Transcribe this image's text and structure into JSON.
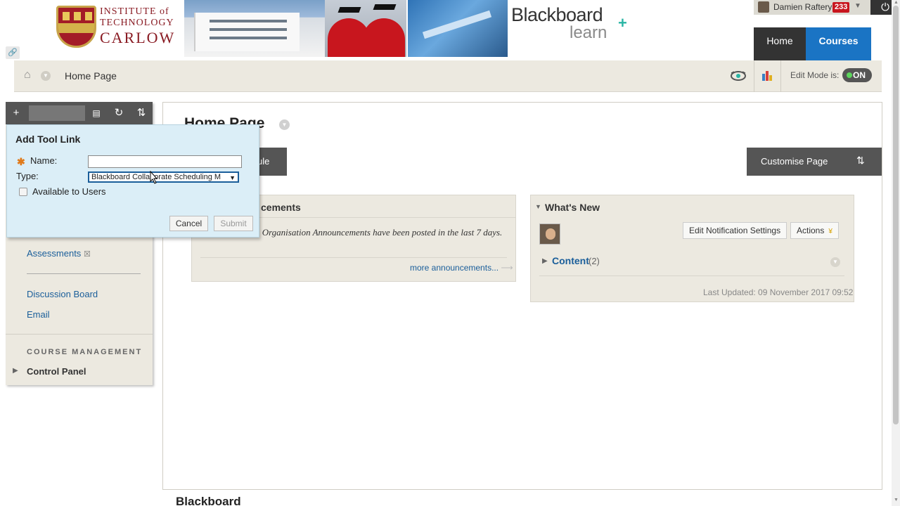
{
  "banner": {
    "institute_line1": "INSTITUTE of",
    "institute_line2": "TECHNOLOGY",
    "institute_line3": "CARLOW",
    "product_name": "Blackboard",
    "product_sub": "learn"
  },
  "user": {
    "name": "Damien Raftery",
    "notifications": "233"
  },
  "top_tabs": {
    "home": "Home",
    "courses": "Courses"
  },
  "breadcrumb": {
    "current": "Home Page",
    "edit_mode_label": "Edit Mode is:",
    "edit_mode_value": "ON"
  },
  "course_menu": {
    "items": [
      {
        "label": "Assessments"
      },
      {
        "label": "Discussion Board"
      },
      {
        "label": "Email"
      }
    ],
    "section_header": "COURSE MANAGEMENT",
    "control_panel": "Control Panel"
  },
  "add_tool_link": {
    "title": "Add Tool Link",
    "name_label": "Name:",
    "name_value": "",
    "type_label": "Type:",
    "type_value": "Blackboard Collaborate Scheduling M",
    "available_label": "Available to Users",
    "available_checked": false,
    "cancel": "Cancel",
    "submit": "Submit"
  },
  "main": {
    "page_title": "Home Page",
    "add_module_partial": "ule",
    "customise_page": "Customise Page"
  },
  "announcements": {
    "title_partial": "cements",
    "message": "Organisation Announcements have been posted in the last 7 days.",
    "more": "more announcements..."
  },
  "whats_new": {
    "title": "What's New",
    "edit_notifications": "Edit Notification Settings",
    "actions": "Actions",
    "content_label": "Content",
    "content_count": "(2)",
    "last_updated": "Last Updated: 09 November 2017 09:52"
  },
  "bottom_peek": "Blackboard"
}
